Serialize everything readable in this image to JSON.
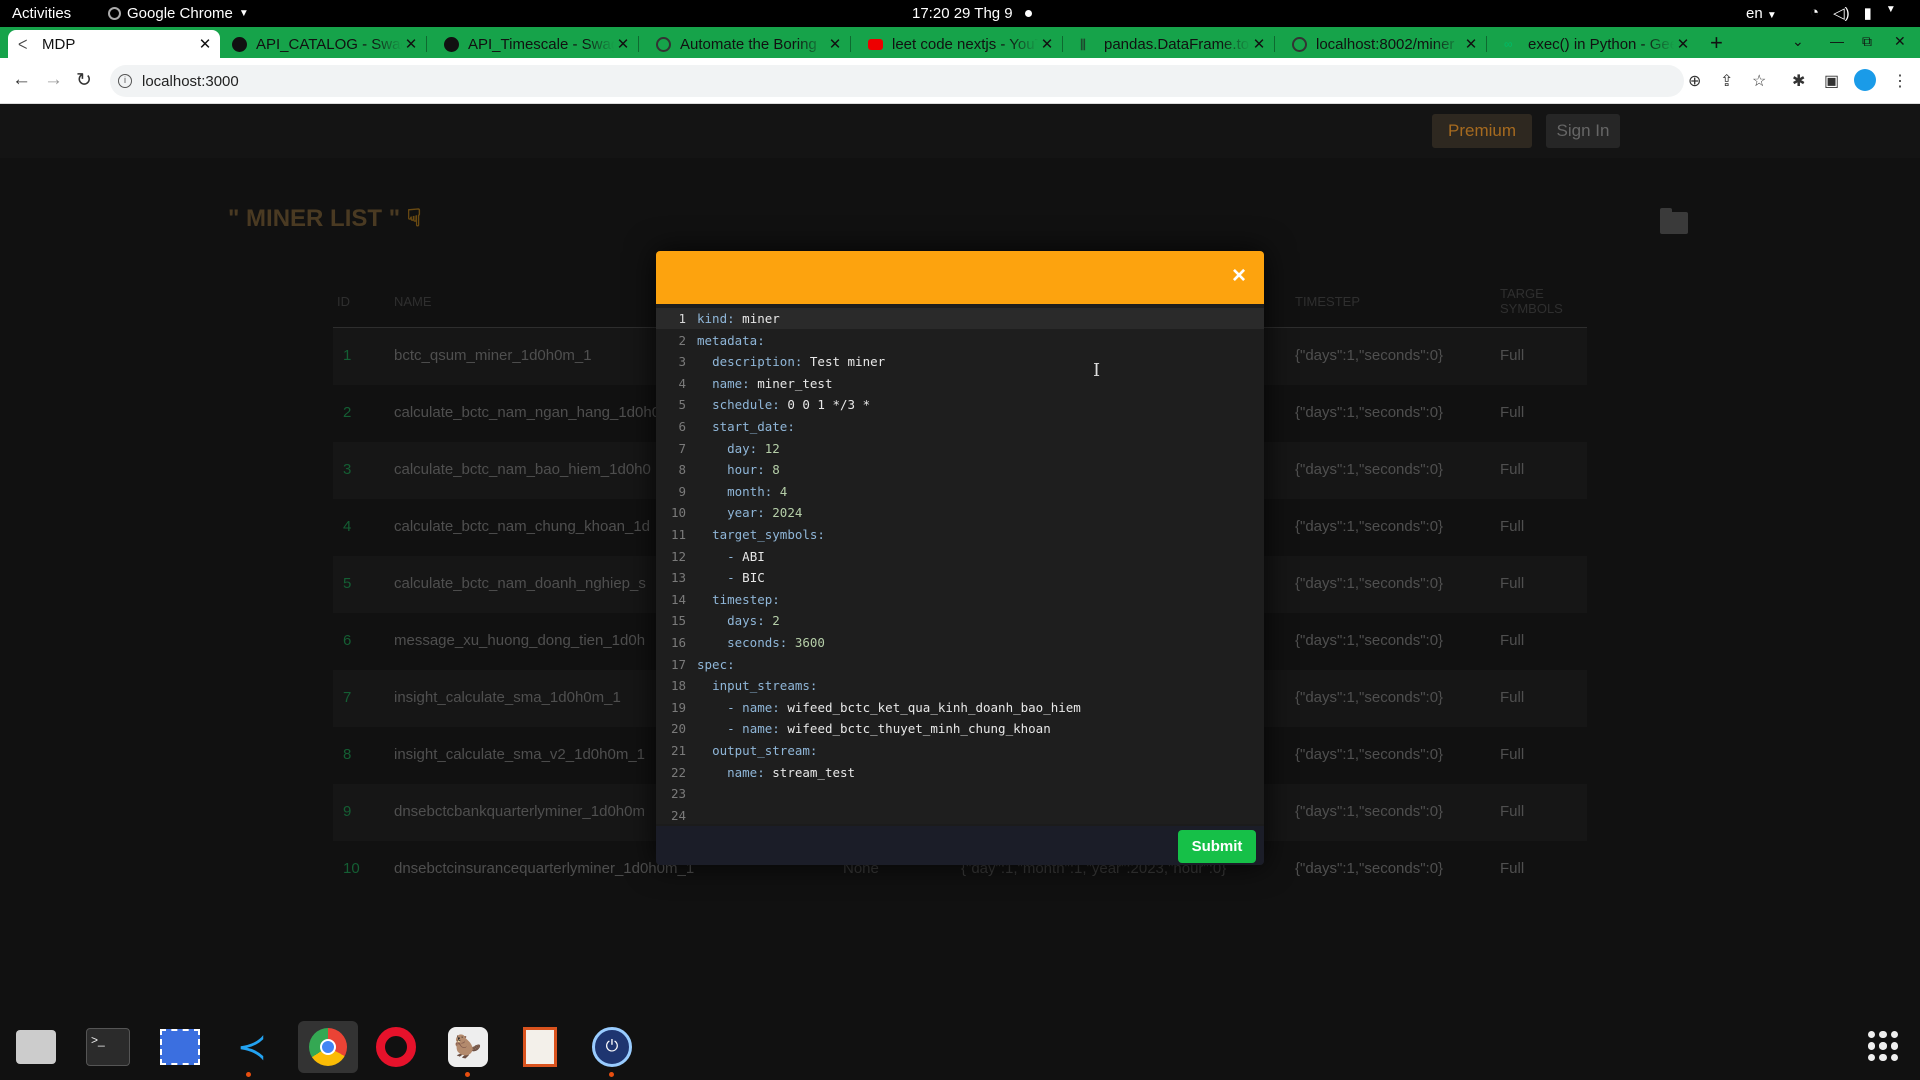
{
  "system_bar": {
    "activities": "Activities",
    "app_name": "Google Chrome",
    "clock": "17:20  29 Thg 9",
    "language": "en"
  },
  "tabs": [
    {
      "label": "MDP",
      "active": true
    },
    {
      "label": "API_CATALOG - Swagger"
    },
    {
      "label": "API_Timescale - Swagger"
    },
    {
      "label": "Automate the Boring"
    },
    {
      "label": "leet code nextjs - YouTube"
    },
    {
      "label": "pandas.DataFrame.to"
    },
    {
      "label": "localhost:8002/miner"
    },
    {
      "label": "exec() in Python - Geeks"
    }
  ],
  "address_bar": {
    "url": "localhost:3000"
  },
  "header": {
    "premium_label": "Premium",
    "signin_label": "Sign In"
  },
  "page": {
    "title": "\" MINER LIST \""
  },
  "table": {
    "columns": {
      "id": "ID",
      "name": "NAME",
      "timestep": "TIMESTEP",
      "target": "TARGE SYMBOLS"
    },
    "rows": [
      {
        "id": "1",
        "name": "bctc_qsum_miner_1d0h0m_1",
        "timestep": "{\"days\":1,\"seconds\":0}",
        "target": "Full"
      },
      {
        "id": "2",
        "name": "calculate_bctc_nam_ngan_hang_1d0h0",
        "timestep": "{\"days\":1,\"seconds\":0}",
        "target": "Full"
      },
      {
        "id": "3",
        "name": "calculate_bctc_nam_bao_hiem_1d0h0",
        "timestep": "{\"days\":1,\"seconds\":0}",
        "target": "Full"
      },
      {
        "id": "4",
        "name": "calculate_bctc_nam_chung_khoan_1d",
        "timestep": "{\"days\":1,\"seconds\":0}",
        "target": "Full"
      },
      {
        "id": "5",
        "name": "calculate_bctc_nam_doanh_nghiep_s",
        "timestep": "{\"days\":1,\"seconds\":0}",
        "target": "Full"
      },
      {
        "id": "6",
        "name": "message_xu_huong_dong_tien_1d0h",
        "timestep": "{\"days\":1,\"seconds\":0}",
        "target": "Full"
      },
      {
        "id": "7",
        "name": "insight_calculate_sma_1d0h0m_1",
        "timestep": "{\"days\":1,\"seconds\":0}",
        "target": "Full"
      },
      {
        "id": "8",
        "name": "insight_calculate_sma_v2_1d0h0m_1",
        "timestep": "{\"days\":1,\"seconds\":0}",
        "target": "Full"
      },
      {
        "id": "9",
        "name": "dnsebctcbankquarterlyminer_1d0h0m",
        "timestep": "{\"days\":1,\"seconds\":0}",
        "target": "Full"
      },
      {
        "id": "10",
        "name": "dnsebctcinsurancequarterlyminer_1d0h0m_1",
        "timestep": "{\"days\":1,\"seconds\":0}",
        "target": "Full",
        "schedule": "None",
        "start": "{\"day\":1,\"month\":1,\"year\":2023,\"hour\":0}"
      }
    ]
  },
  "modal": {
    "close_label": "×",
    "submit_label": "Submit",
    "lines": [
      "kind: miner",
      "metadata:",
      "  description: Test miner",
      "  name: miner_test",
      "  schedule: 0 0 1 */3 *",
      "  start_date:",
      "    day: 12",
      "    hour: 8",
      "    month: 4",
      "    year: 2024",
      "  target_symbols:",
      "    - ABI",
      "    - BIC",
      "  timestep:",
      "    days: 2",
      "    seconds: 3600",
      "spec:",
      "  input_streams:",
      "    - name: wifeed_bctc_ket_qua_kinh_doanh_bao_hiem",
      "    - name: wifeed_bctc_thuyet_minh_chung_khoan",
      "  output_stream:",
      "    name: stream_test",
      "",
      ""
    ]
  },
  "colors": {
    "tabbar": "#16a34a",
    "modal_header": "#fda30e",
    "submit": "#16c048"
  },
  "dock": {
    "apps": [
      "files-icon",
      "terminal-icon",
      "screenshot-icon",
      "vscode-icon",
      "chrome-icon",
      "opera-icon",
      "dbeaver-icon",
      "impress-icon",
      "sleep-icon"
    ]
  }
}
